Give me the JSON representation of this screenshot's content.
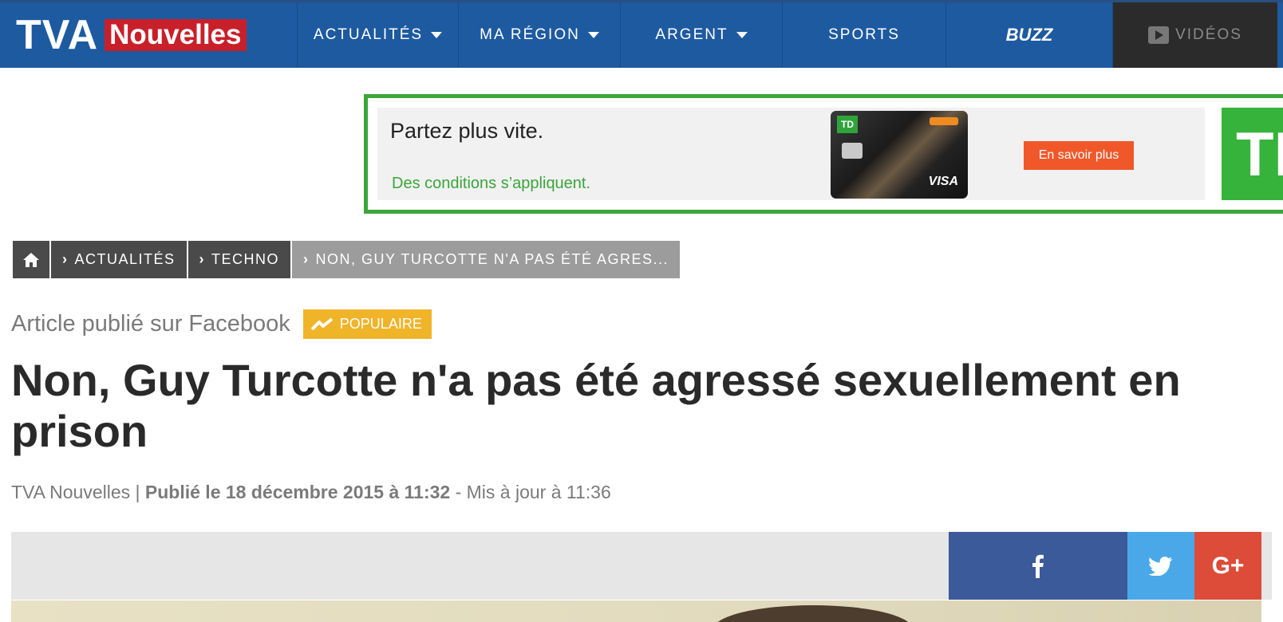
{
  "header": {
    "logo_tva": "TVA",
    "logo_nouvelles": "Nouvelles",
    "nav": [
      {
        "label": "ACTUALITÉS"
      },
      {
        "label": "MA RÉGION"
      },
      {
        "label": "ARGENT"
      },
      {
        "label": "SPORTS"
      },
      {
        "label": "BUZZ"
      },
      {
        "label": "VIDÉOS"
      }
    ]
  },
  "ad": {
    "headline": "Partez plus vite.",
    "conditions": "Des conditions s’appliquent.",
    "button": "En savoir plus",
    "card_brand": "TD",
    "card_network": "VISA",
    "logo": "TD"
  },
  "breadcrumb": {
    "items": [
      "ACTUALITÉS",
      "TECHNO",
      "NON, GUY TURCOTTE N'A PAS ÉTÉ AGRES..."
    ]
  },
  "article": {
    "source": "Article publié sur Facebook",
    "badge": "POPULAIRE",
    "headline": "Non, Guy Turcotte n'a pas été agressé sexuellement en prison",
    "author": "TVA Nouvelles |",
    "published": "Publié le 18 décembre 2015 à 11:32",
    "updated": "- Mis à jour à 11:36"
  },
  "share": {
    "gplus": "G+"
  },
  "colors": {
    "nav_bg": "#1e5aa0",
    "brand_red": "#c8202a",
    "ad_green": "#3aa63a",
    "ad_button": "#f0582a",
    "badge": "#f0b429",
    "facebook": "#3b5a99",
    "twitter": "#4aa8e8",
    "gplus": "#dd4b39"
  }
}
